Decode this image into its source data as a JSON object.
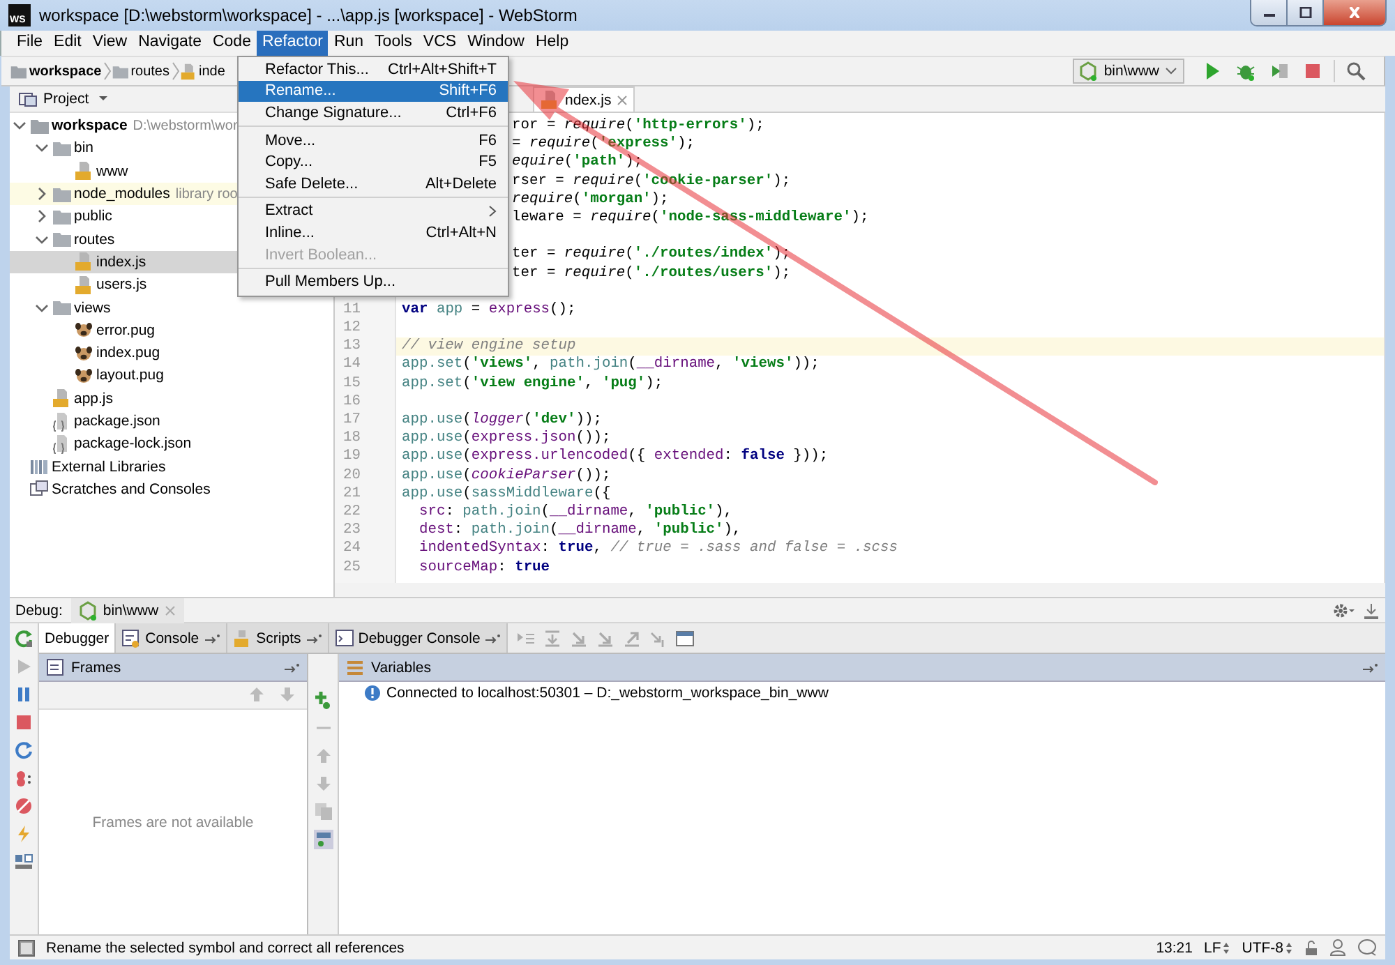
{
  "window": {
    "title": "workspace [D:\\webstorm\\workspace] - ...\\app.js [workspace] - WebStorm",
    "app_icon": "WS"
  },
  "menu_bar": [
    {
      "label": "File",
      "selected": false
    },
    {
      "label": "Edit",
      "selected": false
    },
    {
      "label": "View",
      "selected": false
    },
    {
      "label": "Navigate",
      "selected": false
    },
    {
      "label": "Code",
      "selected": false
    },
    {
      "label": "Refactor",
      "selected": true
    },
    {
      "label": "Run",
      "selected": false
    },
    {
      "label": "Tools",
      "selected": false
    },
    {
      "label": "VCS",
      "selected": false
    },
    {
      "label": "Window",
      "selected": false
    },
    {
      "label": "Help",
      "selected": false
    }
  ],
  "refactor_menu": [
    {
      "kind": "item",
      "label": "Refactor This...",
      "shortcut": "Ctrl+Alt+Shift+T",
      "selected": false,
      "disabled": false
    },
    {
      "kind": "item",
      "label": "Rename...",
      "shortcut": "Shift+F6",
      "selected": true,
      "disabled": false
    },
    {
      "kind": "item",
      "label": "Change Signature...",
      "shortcut": "Ctrl+F6",
      "selected": false,
      "disabled": false
    },
    {
      "kind": "separator"
    },
    {
      "kind": "item",
      "label": "Move...",
      "shortcut": "F6",
      "selected": false,
      "disabled": false
    },
    {
      "kind": "item",
      "label": "Copy...",
      "shortcut": "F5",
      "selected": false,
      "disabled": false
    },
    {
      "kind": "item",
      "label": "Safe Delete...",
      "shortcut": "Alt+Delete",
      "selected": false,
      "disabled": false
    },
    {
      "kind": "separator"
    },
    {
      "kind": "item",
      "label": "Extract",
      "submenu": true,
      "selected": false,
      "disabled": false
    },
    {
      "kind": "item",
      "label": "Inline...",
      "shortcut": "Ctrl+Alt+N",
      "selected": false,
      "disabled": false
    },
    {
      "kind": "item",
      "label": "Invert Boolean...",
      "selected": false,
      "disabled": true
    },
    {
      "kind": "separator"
    },
    {
      "kind": "item",
      "label": "Pull Members Up...",
      "selected": false,
      "disabled": false
    }
  ],
  "breadcrumbs": [
    {
      "label": "workspace",
      "kind": "project"
    },
    {
      "label": "routes",
      "kind": "folder"
    },
    {
      "label": "inde",
      "kind": "js"
    }
  ],
  "run_config": {
    "label": "bin\\www"
  },
  "project_panel": {
    "title": "Project",
    "tree": [
      {
        "label": "workspace",
        "hint": "D:\\webstorm\\wor",
        "kind": "project",
        "expanded": true,
        "selected": false,
        "children": [
          {
            "label": "bin",
            "kind": "folder",
            "expanded": true,
            "selected": false,
            "children": [
              {
                "label": "www",
                "kind": "js",
                "selected": false
              }
            ]
          },
          {
            "label": "node_modules",
            "hint": "library roo",
            "kind": "library",
            "expanded": false,
            "selected": false
          },
          {
            "label": "public",
            "kind": "folder",
            "expanded": false,
            "selected": false
          },
          {
            "label": "routes",
            "kind": "folder",
            "expanded": true,
            "selected": false,
            "children": [
              {
                "label": "index.js",
                "kind": "js",
                "selected": true
              },
              {
                "label": "users.js",
                "kind": "js",
                "selected": false
              }
            ]
          },
          {
            "label": "views",
            "kind": "folder",
            "expanded": true,
            "selected": false,
            "children": [
              {
                "label": "error.pug",
                "kind": "pug",
                "selected": false
              },
              {
                "label": "index.pug",
                "kind": "pug",
                "selected": false
              },
              {
                "label": "layout.pug",
                "kind": "pug",
                "selected": false
              }
            ]
          },
          {
            "label": "app.js",
            "kind": "js",
            "selected": false
          },
          {
            "label": "package.json",
            "kind": "json",
            "selected": false
          },
          {
            "label": "package-lock.json",
            "kind": "json",
            "selected": false
          }
        ]
      },
      {
        "label": "External Libraries",
        "kind": "libraries",
        "selected": false
      },
      {
        "label": "Scratches and Consoles",
        "kind": "scratches",
        "selected": false
      }
    ]
  },
  "editor": {
    "tabs": [
      {
        "label": "ndex.js",
        "selected": true
      }
    ],
    "lines": [
      {
        "kind": "clipped",
        "tokens": [
          {
            "kind": "plain",
            "text": "ror = "
          },
          {
            "kind": "italic",
            "text": "require"
          },
          {
            "kind": "plain",
            "text": "("
          },
          {
            "kind": "string",
            "text": "'http-errors'"
          },
          {
            "kind": "plain",
            "text": ");"
          }
        ]
      },
      {
        "kind": "clipped",
        "tokens": [
          {
            "kind": "plain",
            "text": "= "
          },
          {
            "kind": "italic",
            "text": "require"
          },
          {
            "kind": "plain",
            "text": "("
          },
          {
            "kind": "string",
            "text": "'express'"
          },
          {
            "kind": "plain",
            "text": ");"
          }
        ]
      },
      {
        "kind": "clipped",
        "tokens": [
          {
            "kind": "italic",
            "text": "equire"
          },
          {
            "kind": "plain",
            "text": "("
          },
          {
            "kind": "string",
            "text": "'path'"
          },
          {
            "kind": "plain",
            "text": ");"
          }
        ]
      },
      {
        "kind": "clipped",
        "tokens": [
          {
            "kind": "plain",
            "text": "rser = "
          },
          {
            "kind": "italic",
            "text": "require"
          },
          {
            "kind": "plain",
            "text": "("
          },
          {
            "kind": "string",
            "text": "'cookie-parser'"
          },
          {
            "kind": "plain",
            "text": ");"
          }
        ]
      },
      {
        "kind": "clipped",
        "tokens": [
          {
            "kind": "italic",
            "text": "require"
          },
          {
            "kind": "plain",
            "text": "("
          },
          {
            "kind": "string",
            "text": "'morgan'"
          },
          {
            "kind": "plain",
            "text": ");"
          }
        ]
      },
      {
        "kind": "clipped",
        "tokens": [
          {
            "kind": "plain",
            "text": "leware = "
          },
          {
            "kind": "italic",
            "text": "require"
          },
          {
            "kind": "plain",
            "text": "("
          },
          {
            "kind": "string",
            "text": "'node-sass-middleware'"
          },
          {
            "kind": "plain",
            "text": ");"
          }
        ]
      },
      {
        "kind": "clipped"
      },
      {
        "kind": "clipped",
        "tokens": [
          {
            "kind": "plain",
            "text": "ter = "
          },
          {
            "kind": "italic",
            "text": "require"
          },
          {
            "kind": "plain",
            "text": "("
          },
          {
            "kind": "string",
            "text": "'./routes/index'"
          },
          {
            "kind": "plain",
            "text": ");"
          }
        ]
      },
      {
        "kind": "clipped",
        "tokens": [
          {
            "kind": "plain",
            "text": "ter = "
          },
          {
            "kind": "italic",
            "text": "require"
          },
          {
            "kind": "plain",
            "text": "("
          },
          {
            "kind": "string",
            "text": "'./routes/users'"
          },
          {
            "kind": "plain",
            "text": ");"
          }
        ]
      },
      {
        "kind": "clipped"
      },
      {
        "kind": "full",
        "number": "11",
        "current": false,
        "tokens": [
          {
            "kind": "keyword",
            "text": "var"
          },
          {
            "kind": "global",
            "text": " app"
          },
          {
            "kind": "plain",
            "text": " = "
          },
          {
            "kind": "function",
            "text": "express"
          },
          {
            "kind": "plain",
            "text": "();"
          }
        ]
      },
      {
        "kind": "full",
        "number": "12"
      },
      {
        "kind": "full",
        "number": "13",
        "current": true,
        "tokens": [
          {
            "kind": "comment",
            "text": "// view engine setup"
          }
        ]
      },
      {
        "kind": "full",
        "number": "14",
        "current": false,
        "tokens": [
          {
            "kind": "global",
            "text": "app.set"
          },
          {
            "kind": "plain",
            "text": "("
          },
          {
            "kind": "string",
            "text": "'views'"
          },
          {
            "kind": "plain",
            "text": ", "
          },
          {
            "kind": "global",
            "text": "path.join"
          },
          {
            "kind": "plain",
            "text": "("
          },
          {
            "kind": "function",
            "text": "__dirname"
          },
          {
            "kind": "plain",
            "text": ", "
          },
          {
            "kind": "string",
            "text": "'views'"
          },
          {
            "kind": "plain",
            "text": "));"
          }
        ]
      },
      {
        "kind": "full",
        "number": "15",
        "current": false,
        "tokens": [
          {
            "kind": "global",
            "text": "app.set"
          },
          {
            "kind": "plain",
            "text": "("
          },
          {
            "kind": "string",
            "text": "'view engine'"
          },
          {
            "kind": "plain",
            "text": ", "
          },
          {
            "kind": "string",
            "text": "'pug'"
          },
          {
            "kind": "plain",
            "text": ");"
          }
        ]
      },
      {
        "kind": "full",
        "number": "16"
      },
      {
        "kind": "full",
        "number": "17",
        "current": false,
        "tokens": [
          {
            "kind": "global",
            "text": "app.use"
          },
          {
            "kind": "plain",
            "text": "("
          },
          {
            "kind": "function-italic",
            "text": "logger"
          },
          {
            "kind": "plain",
            "text": "("
          },
          {
            "kind": "string",
            "text": "'dev'"
          },
          {
            "kind": "plain",
            "text": "));"
          }
        ]
      },
      {
        "kind": "full",
        "number": "18",
        "current": false,
        "tokens": [
          {
            "kind": "global",
            "text": "app.use"
          },
          {
            "kind": "plain",
            "text": "("
          },
          {
            "kind": "function",
            "text": "express.json"
          },
          {
            "kind": "plain",
            "text": "());"
          }
        ]
      },
      {
        "kind": "full",
        "number": "19",
        "current": false,
        "tokens": [
          {
            "kind": "global",
            "text": "app.use"
          },
          {
            "kind": "plain",
            "text": "("
          },
          {
            "kind": "function",
            "text": "express.urlencoded"
          },
          {
            "kind": "plain",
            "text": "({"
          },
          {
            "kind": "function",
            "text": " extended"
          },
          {
            "kind": "plain",
            "text": ": "
          },
          {
            "kind": "keyword",
            "text": "false"
          },
          {
            "kind": "plain",
            "text": " }));"
          }
        ]
      },
      {
        "kind": "full",
        "number": "20",
        "current": false,
        "tokens": [
          {
            "kind": "global",
            "text": "app.use"
          },
          {
            "kind": "plain",
            "text": "("
          },
          {
            "kind": "function-italic",
            "text": "cookieParser"
          },
          {
            "kind": "plain",
            "text": "());"
          }
        ]
      },
      {
        "kind": "full",
        "number": "21",
        "current": false,
        "tokens": [
          {
            "kind": "global",
            "text": "app.use"
          },
          {
            "kind": "plain",
            "text": "("
          },
          {
            "kind": "global",
            "text": "sassMiddleware"
          },
          {
            "kind": "plain",
            "text": "({"
          }
        ]
      },
      {
        "kind": "full",
        "number": "22",
        "current": false,
        "tokens": [
          {
            "kind": "function",
            "text": "  src"
          },
          {
            "kind": "plain",
            "text": ": "
          },
          {
            "kind": "global",
            "text": "path.join"
          },
          {
            "kind": "plain",
            "text": "("
          },
          {
            "kind": "function",
            "text": "__dirname"
          },
          {
            "kind": "plain",
            "text": ", "
          },
          {
            "kind": "string",
            "text": "'public'"
          },
          {
            "kind": "plain",
            "text": "),"
          }
        ]
      },
      {
        "kind": "full",
        "number": "23",
        "current": false,
        "tokens": [
          {
            "kind": "function",
            "text": "  dest"
          },
          {
            "kind": "plain",
            "text": ": "
          },
          {
            "kind": "global",
            "text": "path.join"
          },
          {
            "kind": "plain",
            "text": "("
          },
          {
            "kind": "function",
            "text": "__dirname"
          },
          {
            "kind": "plain",
            "text": ", "
          },
          {
            "kind": "string",
            "text": "'public'"
          },
          {
            "kind": "plain",
            "text": "),"
          }
        ]
      },
      {
        "kind": "full",
        "number": "24",
        "current": false,
        "tokens": [
          {
            "kind": "function",
            "text": "  indentedSyntax"
          },
          {
            "kind": "plain",
            "text": ": "
          },
          {
            "kind": "keyword",
            "text": "true"
          },
          {
            "kind": "plain",
            "text": ", "
          },
          {
            "kind": "comment",
            "text": "// true = .sass and false = .scss"
          }
        ]
      },
      {
        "kind": "full",
        "number": "25",
        "current": false,
        "tokens": [
          {
            "kind": "function",
            "text": "  sourceMap"
          },
          {
            "kind": "plain",
            "text": ": "
          },
          {
            "kind": "keyword",
            "text": "true"
          }
        ]
      }
    ]
  },
  "debug": {
    "title": "Debug:",
    "session_tab": {
      "label": "bin\\www"
    },
    "tabs": [
      {
        "label": "Debugger",
        "kind": "plain",
        "selected": true
      },
      {
        "label": "Console",
        "kind": "console",
        "selected": false
      },
      {
        "label": "Scripts",
        "kind": "script",
        "selected": false
      },
      {
        "label": "Debugger Console",
        "kind": "terminal",
        "selected": false
      }
    ],
    "frames": {
      "title": "Frames",
      "empty_text": "Frames are not available"
    },
    "variables": {
      "title": "Variables",
      "messages": [
        "Connected to localhost:50301 – D:_webstorm_workspace_bin_www"
      ]
    }
  },
  "status_bar": {
    "message": "Rename the selected symbol and correct all references",
    "position": "13:21",
    "line_separator": "LF",
    "encoding": "UTF-8"
  }
}
